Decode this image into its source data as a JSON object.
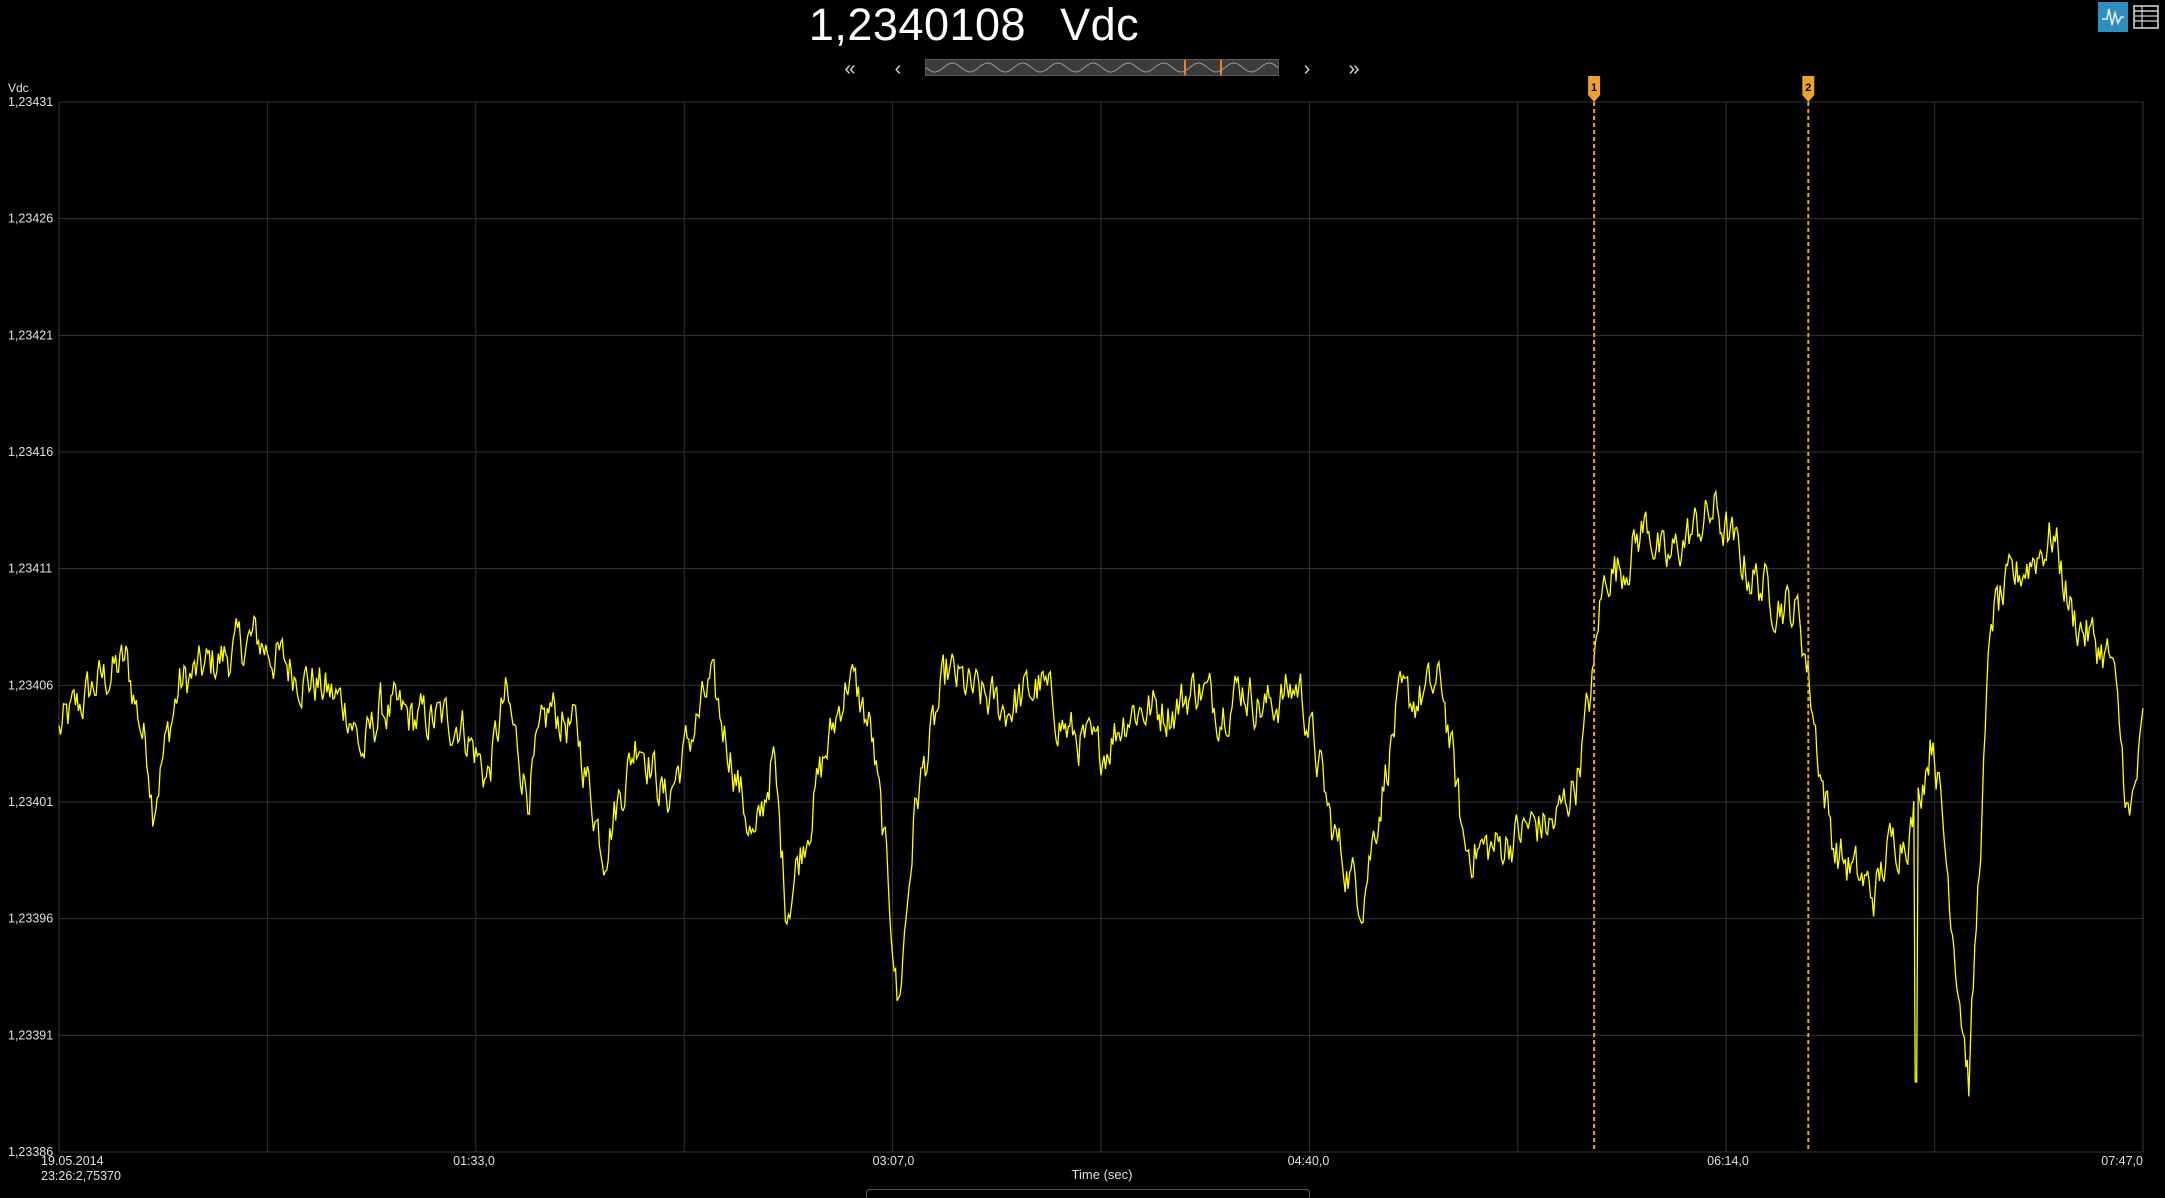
{
  "header": {
    "reading_value": "1,2340108",
    "reading_unit": "Vdc"
  },
  "nav": {
    "first_label": "«",
    "prev_label": "‹",
    "next_label": "›",
    "last_label": "»"
  },
  "toolbar": {
    "chart_view_icon": "waveform-icon",
    "table_view_icon": "table-icon",
    "active_color": "#2e8fbf"
  },
  "chart_data": {
    "type": "line",
    "ylabel": "Vdc",
    "xlabel": "Time (sec)",
    "ylim": [
      1.23386,
      1.23431
    ],
    "xlim": [
      0,
      467
    ],
    "y_ticks": [
      "1,23431",
      "1,23426",
      "1,23421",
      "1,23416",
      "1,23411",
      "1,23406",
      "1,23401",
      "1,23396",
      "1,23391",
      "1,23386"
    ],
    "x_ticks": [
      {
        "t": 93,
        "label": "01:33,0"
      },
      {
        "t": 187,
        "label": "03:07,0"
      },
      {
        "t": 280,
        "label": "04:40,0"
      },
      {
        "t": 374,
        "label": "06:14,0"
      },
      {
        "t": 467,
        "label": "07:47,0"
      }
    ],
    "start_date": "19.05.2014",
    "start_time": "23:26:2,75370",
    "grid": true,
    "line_color": "#ffff00",
    "marker_color": "#f0a030",
    "markers": [
      {
        "label": "1",
        "t": 344
      },
      {
        "label": "2",
        "t": 392
      }
    ],
    "series": [
      {
        "x": [
          0,
          8,
          15,
          20,
          21,
          27,
          35,
          44,
          50,
          58,
          65,
          68,
          72,
          80,
          90,
          96,
          100,
          105,
          110,
          116,
          122,
          130,
          136,
          146,
          150,
          156,
          160,
          163,
          171,
          177,
          182,
          185,
          187,
          188,
          192,
          199,
          206,
          212,
          220,
          226,
          233,
          240,
          250,
          255,
          260,
          265,
          270,
          278,
          283,
          285,
          289,
          292,
          294,
          300,
          310,
          315,
          322,
          330,
          335,
          340,
          344,
          345,
          347,
          350,
          356,
          360,
          363,
          371,
          378,
          383,
          390,
          392,
          395,
          398,
          402,
          407,
          410,
          415,
          420,
          428,
          433,
          440,
          445,
          447,
          451,
          460,
          464,
          467
        ],
        "y": [
          1.23404,
          1.23406,
          1.23407,
          1.23403,
          1.23401,
          1.23406,
          1.23407,
          1.23408,
          1.23407,
          1.23406,
          1.23405,
          1.23403,
          1.23405,
          1.234045,
          1.234045,
          1.23402,
          1.234055,
          1.234015,
          1.23405,
          1.23404,
          1.23399,
          1.23404,
          1.23401,
          1.23406,
          1.234035,
          1.23399,
          1.23403,
          1.233965,
          1.234025,
          1.234065,
          1.23404,
          1.23399,
          1.23395,
          1.23392,
          1.23401,
          1.234065,
          1.234055,
          1.23405,
          1.23406,
          1.23404,
          1.23403,
          1.23405,
          1.23405,
          1.23406,
          1.23405,
          1.23406,
          1.23405,
          1.23406,
          1.23402,
          1.234,
          1.23398,
          1.23397,
          1.23399,
          1.23405,
          1.23406,
          1.23399,
          1.23399,
          1.234,
          1.234,
          1.23402,
          1.234065,
          1.23409,
          1.23411,
          1.23411,
          1.23413,
          1.23411,
          1.23412,
          1.234135,
          1.23411,
          1.2341,
          1.23409,
          1.234065,
          1.23402,
          1.23399,
          1.23398,
          1.23397,
          1.23399,
          1.234,
          1.23404,
          1.23389,
          1.23409,
          1.23411,
          1.23412,
          1.234125,
          1.23409,
          1.23407,
          1.234,
          1.23404
        ]
      }
    ]
  }
}
